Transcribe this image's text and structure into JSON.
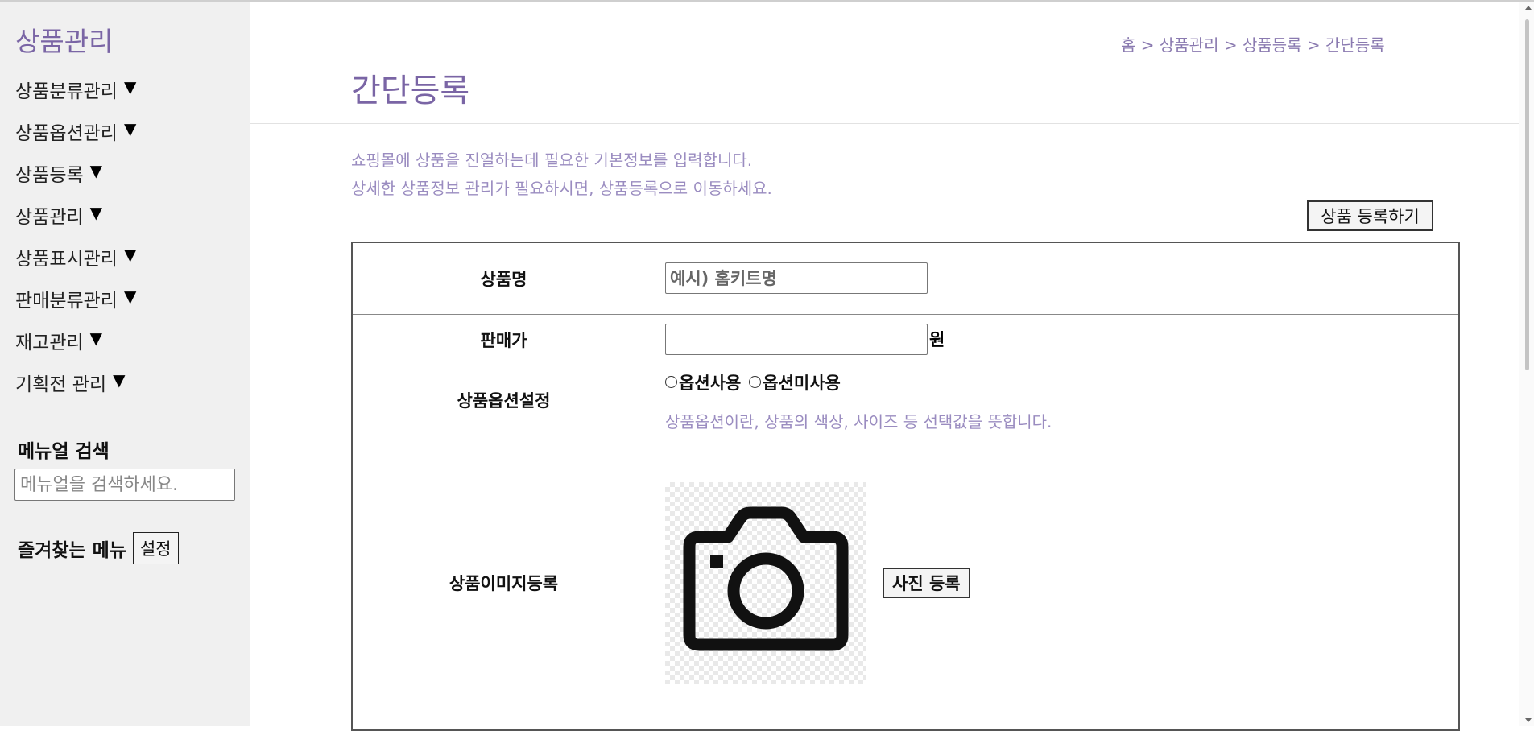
{
  "sidebar": {
    "title": "상품관리",
    "items": [
      {
        "label": "상품분류관리",
        "arrow": "▼"
      },
      {
        "label": "상품옵션관리",
        "arrow": "▼"
      },
      {
        "label": "상품등록",
        "arrow": "▼"
      },
      {
        "label": "상품관리",
        "arrow": "▼"
      },
      {
        "label": "상품표시관리",
        "arrow": "▼"
      },
      {
        "label": "판매분류관리",
        "arrow": "▼"
      },
      {
        "label": "재고관리",
        "arrow": "▼"
      },
      {
        "label": "기획전 관리",
        "arrow": "▼"
      }
    ],
    "manual_search": {
      "title": "메뉴얼 검색",
      "placeholder": "메뉴얼을 검색하세요."
    },
    "favorites": {
      "label": "즐겨찾는 메뉴",
      "button": "설정"
    }
  },
  "main": {
    "breadcrumb": "홈 > 상품관리 > 상품등록 > 간단등록",
    "title": "간단등록",
    "description": [
      "쇼핑몰에 상품을 진열하는데 필요한 기본정보를 입력합니다.",
      "상세한 상품정보 관리가 필요하시면, 상품등록으로 이동하세요."
    ],
    "register_button": "상품 등록하기",
    "form": {
      "product_name": {
        "label": "상품명",
        "placeholder": "예시) 홈키트명",
        "value": ""
      },
      "price": {
        "label": "판매가",
        "value": "",
        "unit": "원"
      },
      "option_setting": {
        "label": "상품옵션설정",
        "radio_use": "옵션사용",
        "radio_no_use": "옵션미사용",
        "note": "상품옵션이란, 상품의 색상, 사이즈 등 선택값을 뜻합니다."
      },
      "image": {
        "label": "상품이미지등록",
        "button": "사진 등록",
        "icon": "camera-icon"
      }
    }
  },
  "colors": {
    "accent": "#7a65a5",
    "sidebar_bg": "#f0f0f0",
    "muted_text": "#9a8cc0"
  }
}
